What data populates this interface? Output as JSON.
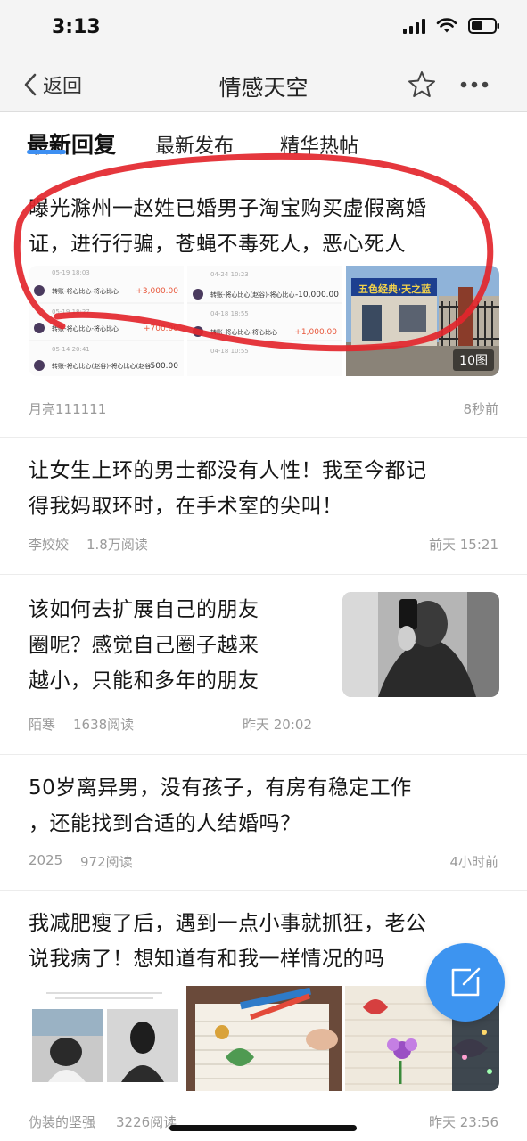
{
  "status_bar": {
    "time": "3:13"
  },
  "nav": {
    "back_label": "返回",
    "title": "情感天空"
  },
  "tabs": [
    {
      "label": "最新回复",
      "active": true
    },
    {
      "label": "最新发布",
      "active": false
    },
    {
      "label": "精华热帖",
      "active": false
    }
  ],
  "posts": [
    {
      "title_line1": "曝光滁州一赵姓已婚男子淘宝购买虚假离婚",
      "title_line2": "证，进行行骗，苍蝇不毒死人，恶心死人",
      "author": "月亮111111",
      "time": "8秒前",
      "image_count": "10图",
      "screenshot_rows_left": [
        {
          "date": "05-19 18:03",
          "label": "转账-将心比心-将心比心",
          "amount": "+3,000.00"
        },
        {
          "date": "05-19 18:27",
          "label": "转账-将心比心-将心比心",
          "amount": "+700.00"
        },
        {
          "date": "05-14 20:41",
          "label": "转账-将心比心(赵谷)-将心比心(赵谷)",
          "amount": "-500.00"
        }
      ],
      "screenshot_rows_right": [
        {
          "date": "04-24 10:23",
          "label": "转账-将心比心(赵谷)-将心比心",
          "amount": "-10,000.00"
        },
        {
          "date": "04-18 18:55",
          "label": "转账-将心比心-将心比心",
          "amount": "+1,000.00"
        },
        {
          "date": "04-18 10:55",
          "label": "",
          "amount": ""
        }
      ],
      "sign_text": "五色经典·天之蓝"
    },
    {
      "title_line1": "让女生上环的男士都没有人性！我至今都记",
      "title_line2": "得我妈取环时，在手术室的尖叫！",
      "author": "李姣姣",
      "reads": "1.8万阅读",
      "time": "前天 15:21"
    },
    {
      "title_line1": "该如何去扩展自己的朋友",
      "title_line2": "圈呢？感觉自己圈子越来",
      "title_line3": "越小，只能和多年的朋友",
      "author": "陌寒",
      "reads": "1638阅读",
      "time": "昨天 20:02"
    },
    {
      "title_line1": "50岁离异男，没有孩子，有房有稳定工作",
      "title_line2": "，还能找到合适的人结婚吗？",
      "author": "2025",
      "reads": "972阅读",
      "time": "4小时前"
    },
    {
      "title_line1": "我减肥瘦了后，遇到一点小事就抓狂，老公",
      "title_line2": "说我病了！想知道有和我一样情况的吗",
      "author": "伪装的坚强",
      "reads": "3226阅读",
      "time": "昨天 23:56"
    }
  ],
  "colors": {
    "accent": "#3d8ff2",
    "fab": "#3d94f0",
    "annotation_red": "#e3262d",
    "meta_gray": "#9a9a9a"
  },
  "icons": [
    "back-chevron-icon",
    "star-icon",
    "more-dots-icon",
    "compose-icon",
    "signal-icon",
    "wifi-icon",
    "battery-icon"
  ]
}
